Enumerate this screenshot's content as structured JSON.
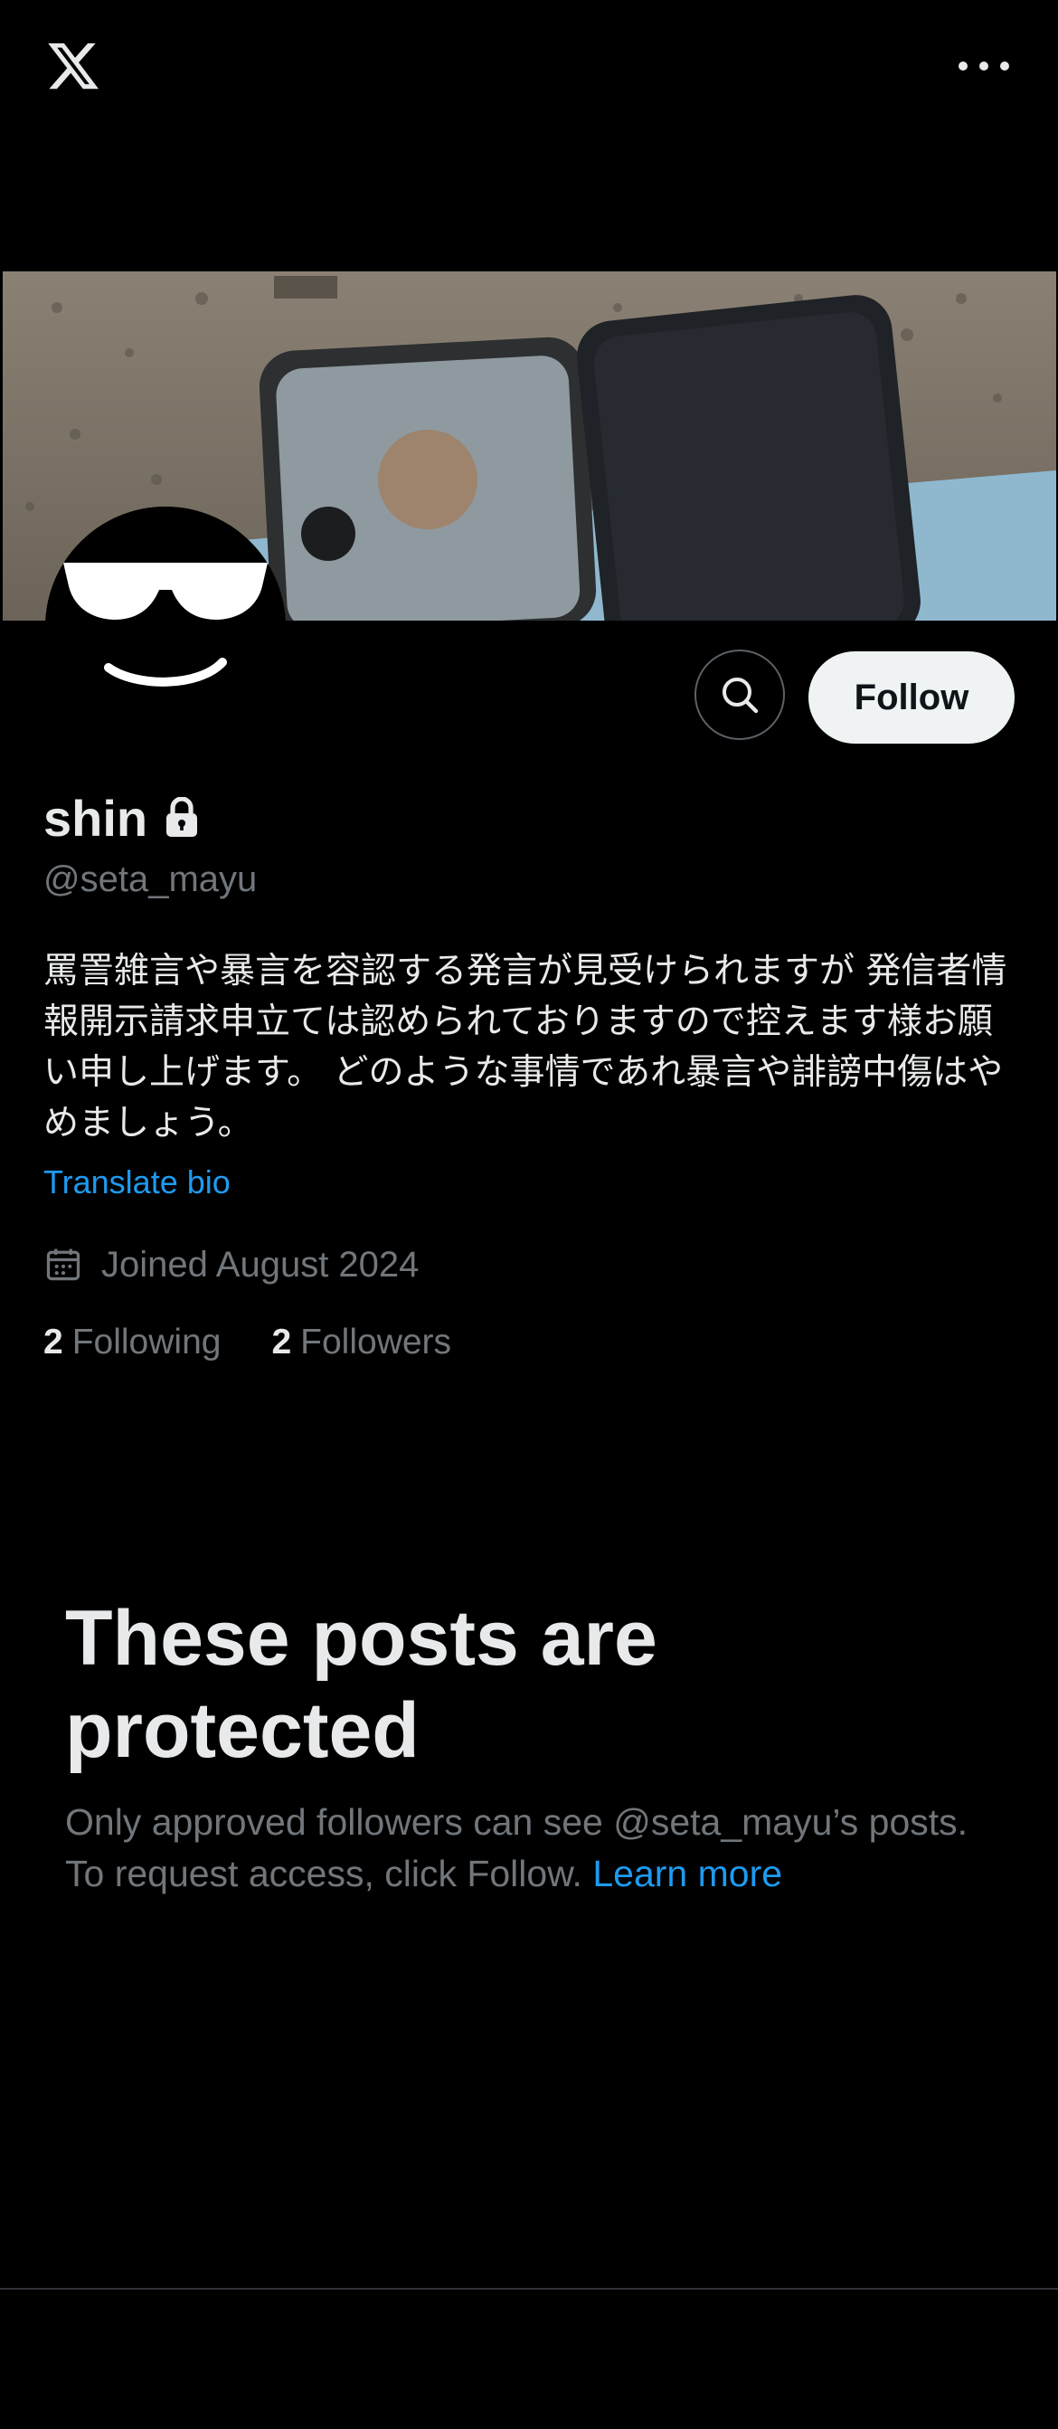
{
  "topbar": {
    "logo_icon": "x-logo-icon",
    "more_icon": "more-horizontal-icon"
  },
  "profile": {
    "display_name": "shin",
    "lock_icon": "lock-icon",
    "handle": "@seta_mayu",
    "bio": "罵詈雑言や暴言を容認する発言が見受けられますが 発信者情報開示請求申立ては認められておりますので控えます様お願い申し上げます。 どのような事情であれ暴言や誹謗中傷はやめましょう。",
    "translate_label": "Translate bio",
    "joined": "Joined August 2024",
    "following_count": "2",
    "following_label": "Following",
    "followers_count": "2",
    "followers_label": "Followers"
  },
  "actions": {
    "search_icon": "search-icon",
    "follow_label": "Follow"
  },
  "protected": {
    "title": "These posts are protected",
    "description": "Only approved followers can see @seta_mayu’s posts. To request access, click Follow.",
    "learn_more": "Learn more"
  },
  "colors": {
    "background": "#000000",
    "text_primary": "#e7e9ea",
    "text_secondary": "#71767b",
    "link": "#1d9bf0",
    "follow_button_bg": "#eff3f4",
    "divider": "#2f3336"
  }
}
